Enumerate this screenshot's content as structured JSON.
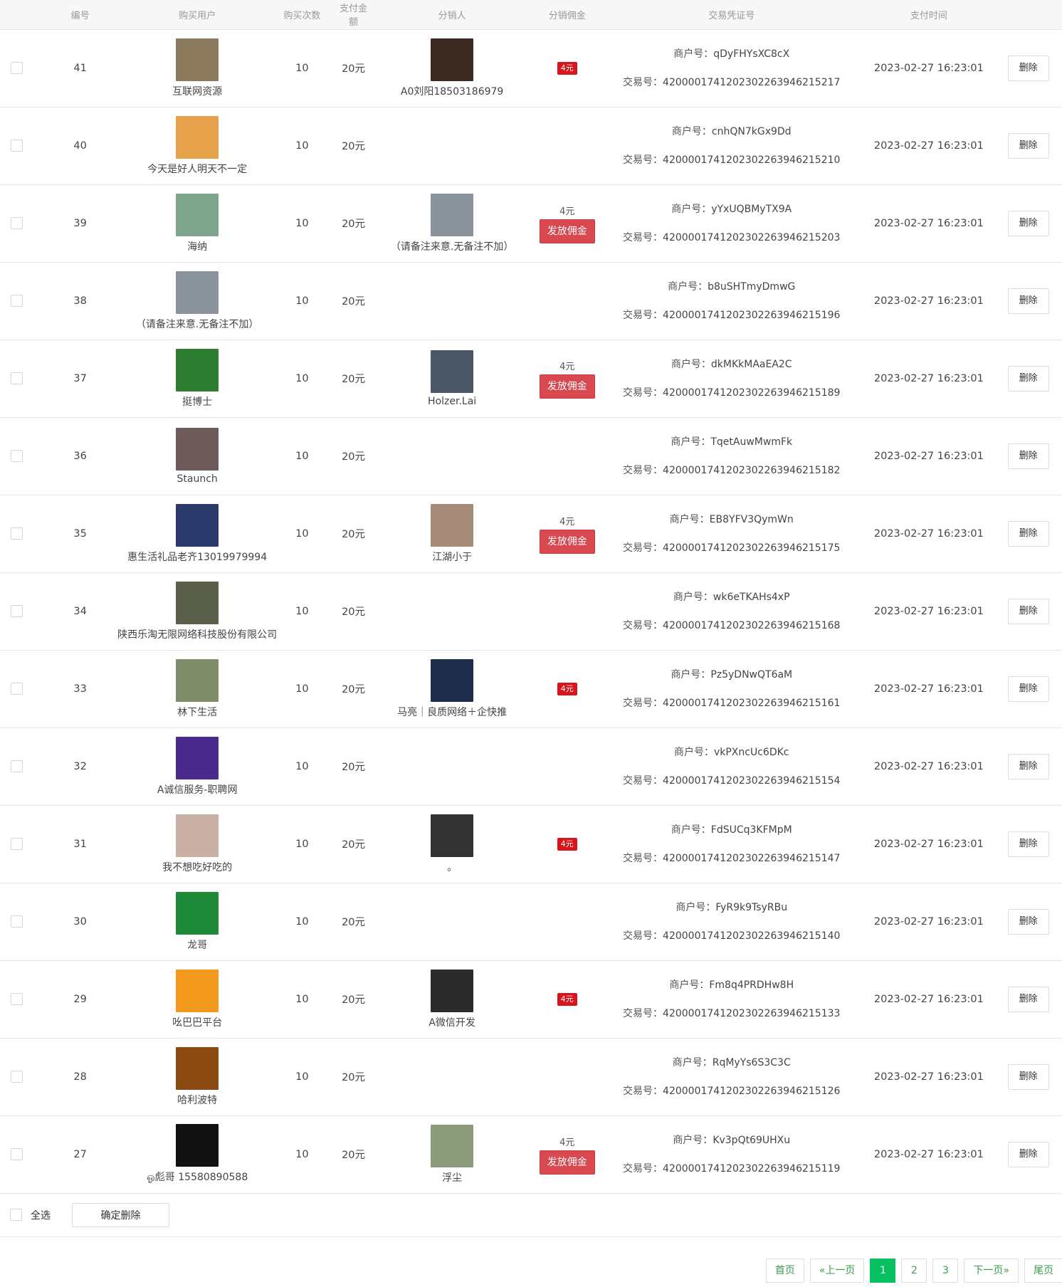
{
  "table": {
    "headers": [
      "",
      "编号",
      "购买用户",
      "购买次数",
      "支付金额",
      "分销人",
      "分销佣金",
      "交易凭证号",
      "支付时间",
      ""
    ],
    "merchant_label": "商户号：",
    "trade_label": "交易号：",
    "pay_button_label": "发放佣金",
    "delete_button_label": "删除",
    "rows": [
      {
        "id": "41",
        "user": "互联网资源",
        "avatar_color": "#8c7a5e",
        "count": "10",
        "amount": "20元",
        "dist": "A0刘阳18503186979",
        "dist_color": "#3a2a22",
        "comm": "4元",
        "comm_state": "tag",
        "merchant": "qDyFHYsXC8cX",
        "trade": "4200001741202302263946215217",
        "time": "2023-02-27 16:23:01"
      },
      {
        "id": "40",
        "user": "今天是好人明天不一定",
        "avatar_color": "#e7a34b",
        "count": "10",
        "amount": "20元",
        "dist": "",
        "dist_color": "",
        "comm": "",
        "comm_state": "none",
        "merchant": "cnhQN7kGx9Dd",
        "trade": "4200001741202302263946215210",
        "time": "2023-02-27 16:23:01"
      },
      {
        "id": "39",
        "user": "海纳",
        "avatar_color": "#7ea58b",
        "count": "10",
        "amount": "20元",
        "dist": "（请备注来意.无备注不加）",
        "dist_color": "#8a939c",
        "comm": "4元",
        "comm_state": "button",
        "merchant": "yYxUQBMyTX9A",
        "trade": "4200001741202302263946215203",
        "time": "2023-02-27 16:23:01"
      },
      {
        "id": "38",
        "user": "（请备注来意.无备注不加）",
        "avatar_color": "#8a939c",
        "count": "10",
        "amount": "20元",
        "dist": "",
        "dist_color": "",
        "comm": "",
        "comm_state": "none",
        "merchant": "b8uSHTmyDmwG",
        "trade": "4200001741202302263946215196",
        "time": "2023-02-27 16:23:01"
      },
      {
        "id": "37",
        "user": "挺博士",
        "avatar_color": "#2e7d32",
        "count": "10",
        "amount": "20元",
        "dist": "Holzer.Lai",
        "dist_color": "#4a5566",
        "comm": "4元",
        "comm_state": "button",
        "merchant": "dkMKkMAaEA2C",
        "trade": "4200001741202302263946215189",
        "time": "2023-02-27 16:23:01"
      },
      {
        "id": "36",
        "user": "Staunch",
        "avatar_color": "#6d5a5a",
        "count": "10",
        "amount": "20元",
        "dist": "",
        "dist_color": "",
        "comm": "",
        "comm_state": "none",
        "merchant": "TqetAuwMwmFk",
        "trade": "4200001741202302263946215182",
        "time": "2023-02-27 16:23:01"
      },
      {
        "id": "35",
        "user": "惠生活礼品老齐13019979994",
        "avatar_color": "#2b3a6b",
        "count": "10",
        "amount": "20元",
        "dist": "江湖小于",
        "dist_color": "#a58a7a",
        "comm": "4元",
        "comm_state": "button",
        "merchant": "EB8YFV3QymWn",
        "trade": "4200001741202302263946215175",
        "time": "2023-02-27 16:23:01"
      },
      {
        "id": "34",
        "user": "陕西乐淘无限网络科技股份有限公司",
        "avatar_color": "#5a5f4a",
        "count": "10",
        "amount": "20元",
        "dist": "",
        "dist_color": "",
        "comm": "",
        "comm_state": "none",
        "merchant": "wk6eTKAHs4xP",
        "trade": "4200001741202302263946215168",
        "time": "2023-02-27 16:23:01"
      },
      {
        "id": "33",
        "user": "林下生活",
        "avatar_color": "#7e8c6a",
        "count": "10",
        "amount": "20元",
        "dist": "马亮｜良质网络＋企快推",
        "dist_color": "#1f2d4d",
        "comm": "4元",
        "comm_state": "tag",
        "merchant": "Pz5yDNwQT6aM",
        "trade": "4200001741202302263946215161",
        "time": "2023-02-27 16:23:01"
      },
      {
        "id": "32",
        "user": "A诚信服务-职聘网",
        "avatar_color": "#4a2a8c",
        "count": "10",
        "amount": "20元",
        "dist": "",
        "dist_color": "",
        "comm": "",
        "comm_state": "none",
        "merchant": "vkPXncUc6DKc",
        "trade": "4200001741202302263946215154",
        "time": "2023-02-27 16:23:01"
      },
      {
        "id": "31",
        "user": "我不想吃好吃的",
        "avatar_color": "#c9b2a5",
        "count": "10",
        "amount": "20元",
        "dist": "。",
        "dist_color": "#333333",
        "comm": "4元",
        "comm_state": "tag",
        "merchant": "FdSUCq3KFMpM",
        "trade": "4200001741202302263946215147",
        "time": "2023-02-27 16:23:01"
      },
      {
        "id": "30",
        "user": "龙哥",
        "avatar_color": "#1f8a3a",
        "count": "10",
        "amount": "20元",
        "dist": "",
        "dist_color": "",
        "comm": "",
        "comm_state": "none",
        "merchant": "FyR9k9TsyRBu",
        "trade": "4200001741202302263946215140",
        "time": "2023-02-27 16:23:01"
      },
      {
        "id": "29",
        "user": "吆巴巴平台",
        "avatar_color": "#f39a1e",
        "count": "10",
        "amount": "20元",
        "dist": "A微信开发",
        "dist_color": "#2a2a2a",
        "comm": "4元",
        "comm_state": "tag",
        "merchant": "Fm8q4PRDHw8H",
        "trade": "4200001741202302263946215133",
        "time": "2023-02-27 16:23:01"
      },
      {
        "id": "28",
        "user": "哈利波特",
        "avatar_color": "#8a4a12",
        "count": "10",
        "amount": "20元",
        "dist": "",
        "dist_color": "",
        "comm": "",
        "comm_state": "none",
        "merchant": "RqMyYs6S3C3C",
        "trade": "4200001741202302263946215126",
        "time": "2023-02-27 16:23:01"
      },
      {
        "id": "27",
        "user": "ஓ彪哥 15580890588",
        "avatar_color": "#111111",
        "count": "10",
        "amount": "20元",
        "dist": "浮尘",
        "dist_color": "#8a9a7a",
        "comm": "4元",
        "comm_state": "button",
        "merchant": "Kv3pQt69UHXu",
        "trade": "4200001741202302263946215119",
        "time": "2023-02-27 16:23:01"
      }
    ]
  },
  "footer": {
    "select_all_label": "全选",
    "confirm_delete_label": "确定删除"
  },
  "pagination": {
    "first": "首页",
    "prev": "«上一页",
    "pages": [
      "1",
      "2",
      "3"
    ],
    "current": "1",
    "next": "下一页»",
    "last": "尾页"
  }
}
